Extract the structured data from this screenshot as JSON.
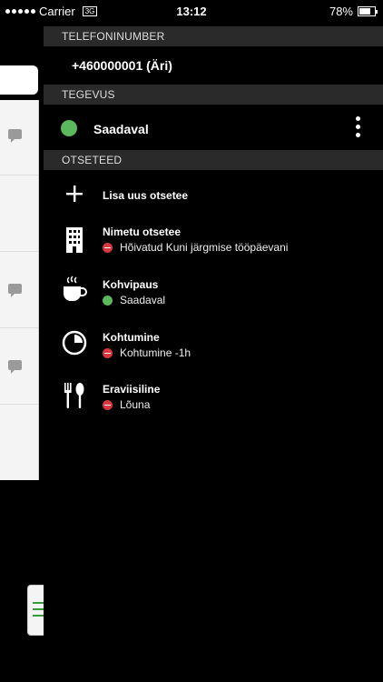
{
  "status_bar": {
    "carrier": "Carrier",
    "network": "3G",
    "time": "13:12",
    "battery_percent": "78%",
    "battery_level": 0.78
  },
  "drawer": {
    "phone_section": {
      "header": "TELEFONINUMBER",
      "number": "+460000001 (Äri)"
    },
    "activity_section": {
      "header": "TEGEVUS",
      "status_label": "Saadaval",
      "status_color": "#5cb85c"
    },
    "shortcuts_section": {
      "header": "OTSETEED",
      "add_label": "Lisa uus otsetee",
      "items": [
        {
          "title": "Nimetu otsetee",
          "status": "Hõivatud Kuni järgmise tööpäevani",
          "state": "busy",
          "icon": "building-icon"
        },
        {
          "title": "Kohvipaus",
          "status": "Saadaval",
          "state": "available",
          "icon": "coffee-icon"
        },
        {
          "title": "Kohtumine",
          "status": "Kohtumine -1h",
          "state": "busy",
          "icon": "clock-icon"
        },
        {
          "title": "Eraviisiline",
          "status": "Lõuna",
          "state": "busy",
          "icon": "fork-spoon-icon"
        }
      ]
    }
  },
  "colors": {
    "available": "#5cb85c",
    "busy": "#d9363e",
    "header_bg": "#2a2a2a"
  }
}
